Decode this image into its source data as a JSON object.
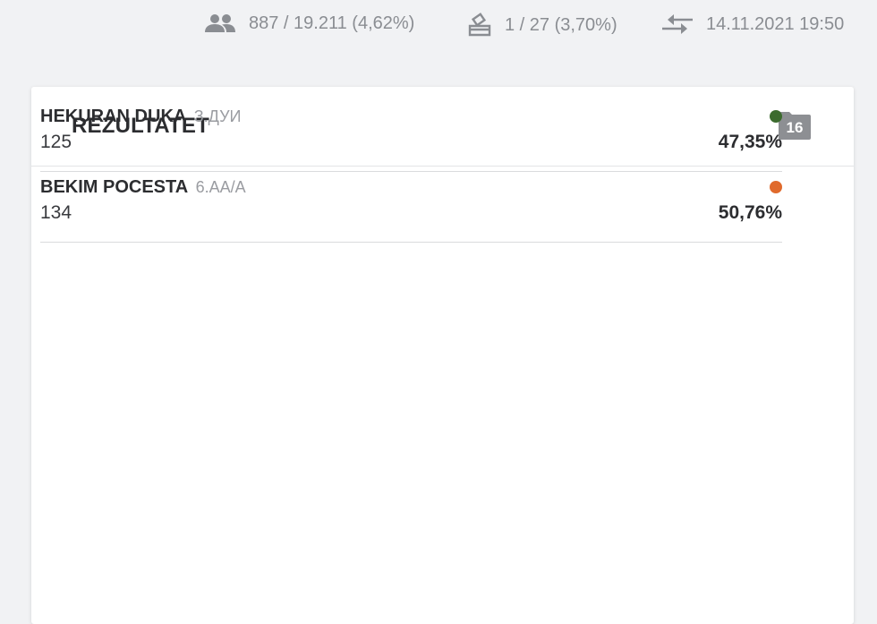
{
  "stats": {
    "voters": {
      "icon": "people-icon",
      "text": "887 / 19.211 (4,62%)"
    },
    "stations": {
      "icon": "ballot-box-icon",
      "text": "1 / 27 (3,70%)"
    },
    "updated": {
      "icon": "swap-arrows-icon",
      "text": "14.11.2021 19:50"
    }
  },
  "card": {
    "title": "REZULTATET",
    "badge": {
      "icon": "folder-icon",
      "value": "16"
    }
  },
  "results": [
    {
      "name": "HEKURAN DUKA",
      "party": "З.ДУИ",
      "votes": "125",
      "percent": "47,35%",
      "color": "#3c6b2e"
    },
    {
      "name": "BEKIM POCESTA",
      "party": "6.АА/А",
      "votes": "134",
      "percent": "50,76%",
      "color": "#e06a2c"
    }
  ]
}
